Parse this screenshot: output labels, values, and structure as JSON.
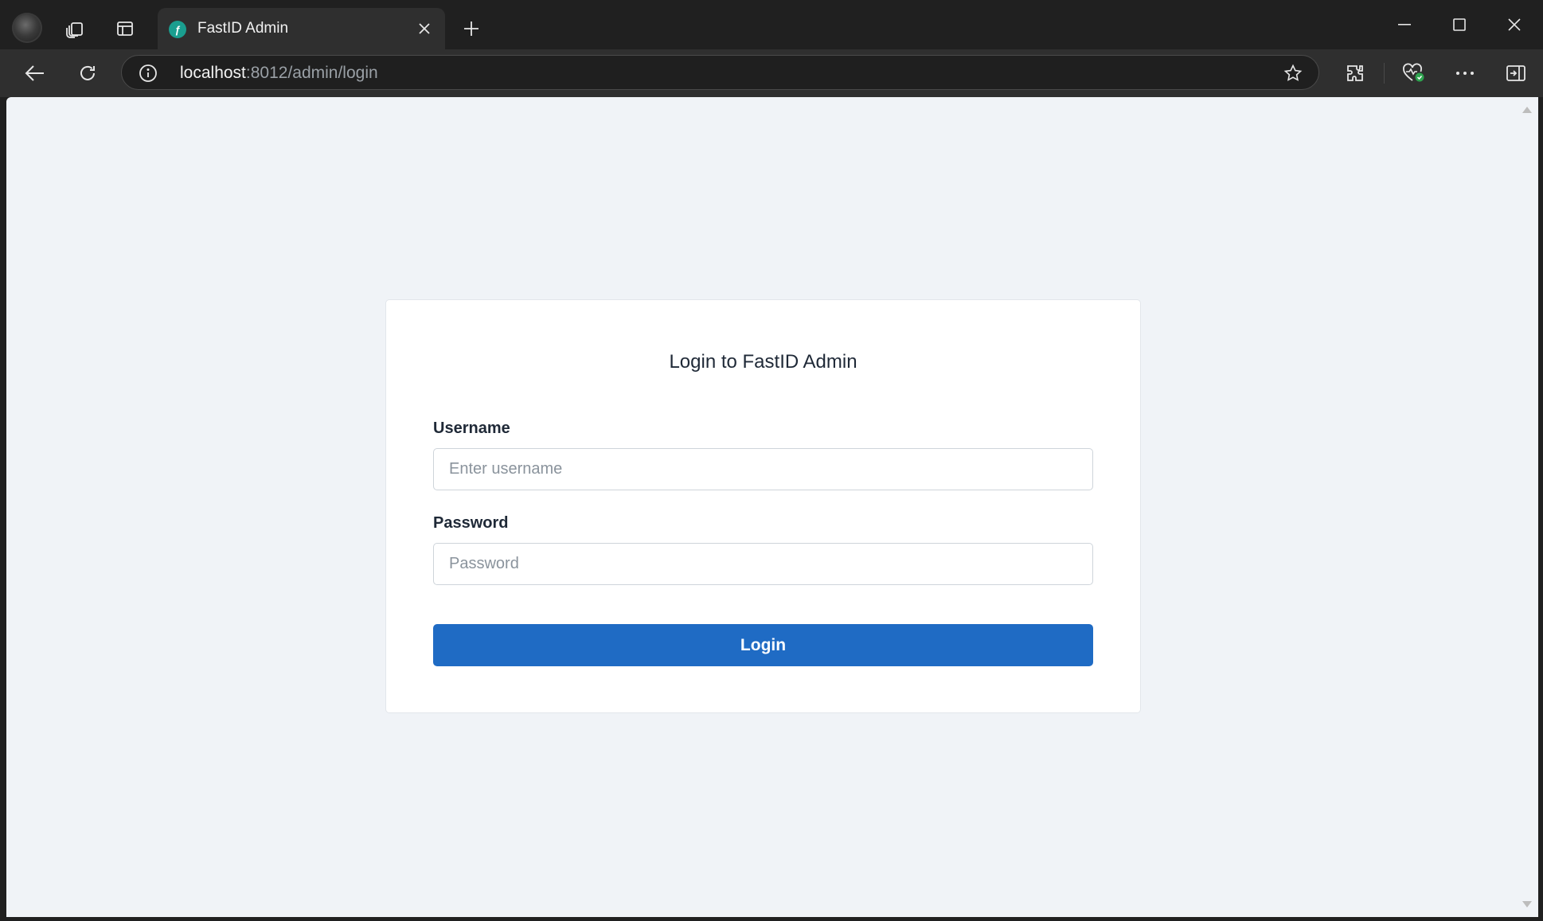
{
  "browser": {
    "tab": {
      "title": "FastID Admin",
      "favicon": "fastid-favicon"
    },
    "address": {
      "host": "localhost",
      "path": ":8012/admin/login"
    }
  },
  "page": {
    "title": "Login to FastID Admin",
    "username": {
      "label": "Username",
      "placeholder": "Enter username",
      "value": ""
    },
    "password": {
      "label": "Password",
      "placeholder": "Password",
      "value": ""
    },
    "submit_label": "Login"
  },
  "colors": {
    "accent": "#1f6bc4",
    "page_background": "#f0f3f7",
    "browser_chrome": "#202020"
  }
}
